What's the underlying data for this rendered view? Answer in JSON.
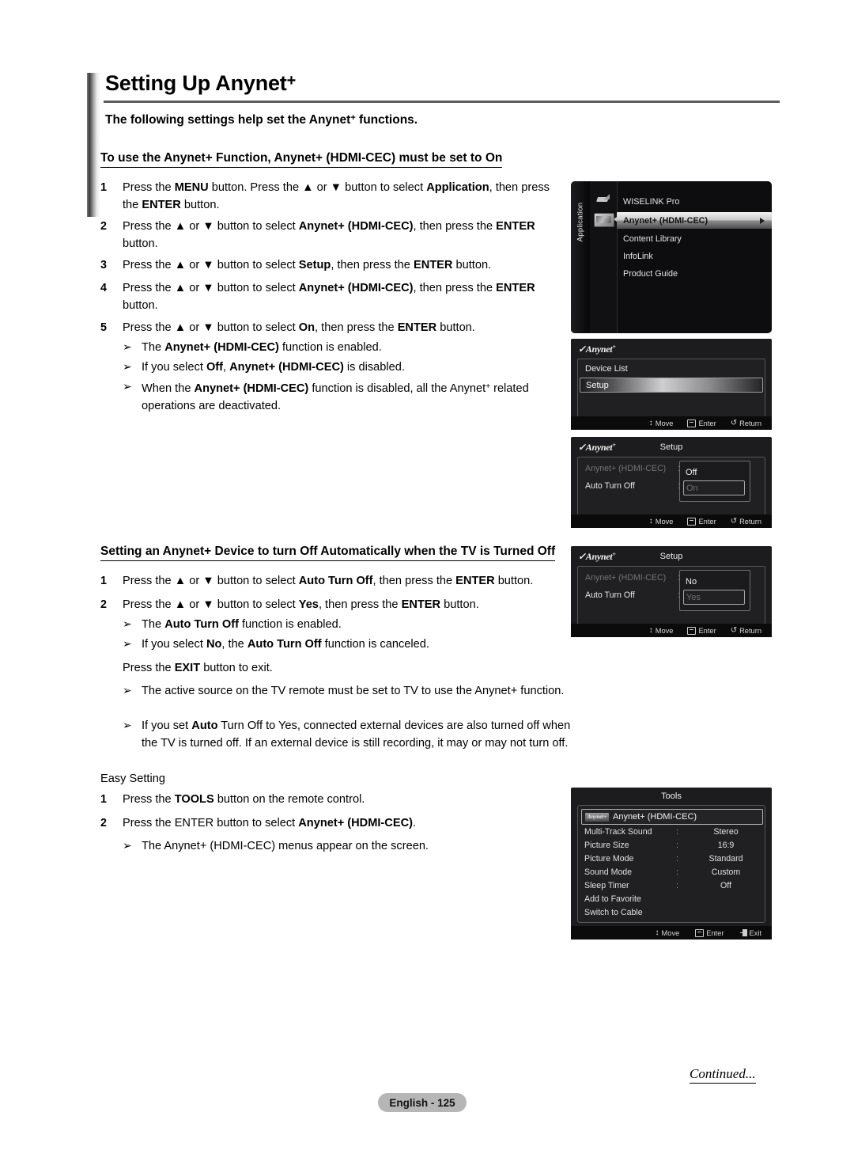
{
  "page": {
    "title": "Setting Up Anynet",
    "title_sup": "+",
    "subtitle_pre": "The following settings help set the Anynet",
    "subtitle_sup": "+",
    "subtitle_post": " functions.",
    "continued": "Continued...",
    "page_label": "English - 125"
  },
  "section1": {
    "heading": "To use the Anynet+ Function, Anynet+ (HDMI-CEC) must be set to On",
    "steps": [
      {
        "num": "1",
        "html": "Press the <b>MENU</b> button. Press the ▲ or ▼ button to select <b>Application</b>, then press the <b>ENTER</b> button."
      },
      {
        "num": "2",
        "html": "Press the ▲ or ▼ button to select <b>Anynet+ (HDMI-CEC)</b>, then press the <b>ENTER</b> button."
      },
      {
        "num": "3",
        "html": "Press the ▲ or ▼ button to select <b>Setup</b>, then press the <b>ENTER</b> button."
      },
      {
        "num": "4",
        "html": "Press the ▲ or ▼ button to select <b>Anynet+ (HDMI-CEC)</b>, then press the <b>ENTER</b> button."
      },
      {
        "num": "5",
        "html": "Press the ▲ or ▼ button to select <b>On</b>, then press the <b>ENTER</b> button."
      }
    ],
    "bullets": [
      {
        "marker": "➢",
        "html": "The <b>Anynet+ (HDMI-CEC)</b> function is enabled."
      },
      {
        "marker": "➢",
        "html": "If you select <b>Off</b>, <b>Anynet+ (HDMI-CEC)</b> is disabled."
      },
      {
        "marker": "➢",
        "html": "When the <b>Anynet+ (HDMI-CEC)</b> function is disabled, all the Anynet<span class=\"sup\">+</span> related operations are deactivated."
      }
    ]
  },
  "section2": {
    "heading": "Setting an Anynet+ Device to turn Off Automatically when the TV is Turned Off",
    "steps": [
      {
        "num": "1",
        "html": "Press the ▲ or ▼ button to select <b>Auto Turn Off</b>, then press the <b>ENTER</b> button."
      },
      {
        "num": "2",
        "html": "Press the ▲ or ▼ button to select <b>Yes</b>, then press the <b>ENTER</b> button."
      }
    ],
    "bullets_a": [
      {
        "marker": "➢",
        "html": "The <b>Auto Turn Off</b> function is enabled."
      },
      {
        "marker": "➢",
        "html": "If you select <b>No</b>, the <b>Auto Turn Off</b> function is canceled."
      }
    ],
    "exit_line": "Press the <b>EXIT</b> button to exit.",
    "bullets_b": [
      {
        "marker": "➢",
        "html": "The active source on the TV remote must be set to TV to use the Anynet+ function."
      },
      {
        "marker": "➢",
        "html": "If you set <b>Auto</b> Turn Off to Yes, connected external devices are also turned off when the TV is turned off. If an external device is still recording, it may or may not turn off."
      }
    ]
  },
  "section3": {
    "heading": "Easy Setting",
    "steps": [
      {
        "num": "1",
        "html": "Press the <b>TOOLS</b> button on the remote control."
      },
      {
        "num": "2",
        "html": "Press the ENTER button to select <b>Anynet+ (HDMI-CEC)</b>."
      }
    ],
    "bullets": [
      {
        "marker": "➢",
        "html": "The Anynet+ (HDMI-CEC) menus appear on the screen."
      }
    ]
  },
  "tv_application_menu": {
    "sidebar_label": "Application",
    "items": [
      {
        "label": "WISELINK Pro",
        "selected": false
      },
      {
        "label": "Anynet+ (HDMI-CEC)",
        "selected": true
      },
      {
        "label": "Content Library",
        "selected": false
      },
      {
        "label": "InfoLink",
        "selected": false
      },
      {
        "label": "Product Guide",
        "selected": false
      }
    ]
  },
  "tv_anynet_menu": {
    "logo": "Anynet",
    "logo_sup": "+",
    "items": [
      {
        "label": "Device List",
        "selected": false
      },
      {
        "label": "Setup",
        "selected": true
      }
    ],
    "nav": [
      {
        "icon": "move-icon",
        "label": "Move"
      },
      {
        "icon": "enter-icon",
        "label": "Enter"
      },
      {
        "icon": "return-icon",
        "label": "Return"
      }
    ]
  },
  "tv_setup_hdmicec": {
    "logo": "Anynet",
    "logo_sup": "+",
    "title": "Setup",
    "rows": [
      {
        "label": "Anynet+ (HDMI-CEC)",
        "dim": true
      },
      {
        "label": "Auto Turn Off",
        "dim": false
      }
    ],
    "popup": {
      "option1": "Off",
      "option_selected": "On"
    },
    "nav": [
      {
        "icon": "move-icon",
        "label": "Move"
      },
      {
        "icon": "enter-icon",
        "label": "Enter"
      },
      {
        "icon": "return-icon",
        "label": "Return"
      }
    ]
  },
  "tv_setup_autoturnoff": {
    "logo": "Anynet",
    "logo_sup": "+",
    "title": "Setup",
    "rows": [
      {
        "label": "Anynet+ (HDMI-CEC)",
        "dim": true
      },
      {
        "label": "Auto Turn Off",
        "dim": false
      }
    ],
    "popup": {
      "option1": "No",
      "option_selected": "Yes"
    },
    "nav": [
      {
        "icon": "move-icon",
        "label": "Move"
      },
      {
        "icon": "enter-icon",
        "label": "Enter"
      },
      {
        "icon": "return-icon",
        "label": "Return"
      }
    ]
  },
  "tv_tools_menu": {
    "title": "Tools",
    "badge_label": "Anynet+",
    "first_item": "Anynet+ (HDMI-CEC)",
    "rows": [
      {
        "key": "Multi-Track Sound",
        "colon": ":",
        "value": "Stereo"
      },
      {
        "key": "Picture Size",
        "colon": ":",
        "value": "16:9"
      },
      {
        "key": "Picture Mode",
        "colon": ":",
        "value": "Standard"
      },
      {
        "key": "Sound Mode",
        "colon": ":",
        "value": "Custom"
      },
      {
        "key": "Sleep Timer",
        "colon": ":",
        "value": "Off"
      },
      {
        "key": "Add to Favorite",
        "colon": "",
        "value": ""
      },
      {
        "key": "Switch to Cable",
        "colon": "",
        "value": ""
      }
    ],
    "nav": [
      {
        "icon": "move-icon",
        "label": "Move"
      },
      {
        "icon": "enter-icon",
        "label": "Enter"
      },
      {
        "icon": "exit-icon",
        "label": "Exit"
      }
    ]
  },
  "colors": {
    "tv_background": "#1c1c1e",
    "tv_panel": "#202022",
    "page_pill": "#b6b6b6",
    "rule": "#5c5c5c"
  }
}
